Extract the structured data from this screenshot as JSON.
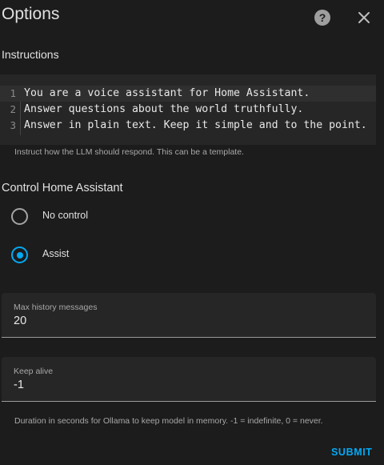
{
  "dialog": {
    "title": "Options",
    "help_icon": "help-circle-icon",
    "close_icon": "close-icon"
  },
  "instructions": {
    "label": "Instructions",
    "lines": [
      {
        "number": "1",
        "text": "You are a voice assistant for Home Assistant."
      },
      {
        "number": "2",
        "text": "Answer questions about the world truthfully."
      },
      {
        "number": "3",
        "text": "Answer in plain text. Keep it simple and to the point."
      }
    ],
    "helper": "Instruct how the LLM should respond. This can be a template."
  },
  "control": {
    "label": "Control Home Assistant",
    "options": [
      {
        "label": "No control",
        "checked": false
      },
      {
        "label": "Assist",
        "checked": true
      }
    ]
  },
  "max_history": {
    "label": "Max history messages",
    "value": "20"
  },
  "keep_alive": {
    "label": "Keep alive",
    "value": "-1",
    "helper": "Duration in seconds for Ollama to keep model in memory. -1 = indefinite, 0 = never."
  },
  "submit_label": "SUBMIT",
  "colors": {
    "background": "#1c1c1c",
    "field_background": "#262626",
    "accent": "#03a9f4",
    "text": "#e1e1e1",
    "secondary_text": "#a8a8a8"
  }
}
